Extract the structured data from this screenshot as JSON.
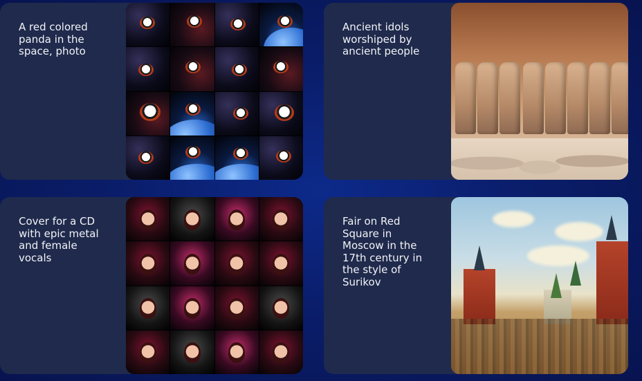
{
  "cards": [
    {
      "text": "A red colored\npanda in the\nspace, photo",
      "image_alt": "red panda in space grid"
    },
    {
      "text": "Ancient idols\nworshiped by\nancient people",
      "image_alt": "ancient stone idols"
    },
    {
      "text": "Cover for a CD\nwith epic metal\nand female\nvocals",
      "image_alt": "metal album covers grid"
    },
    {
      "text": "Fair on Red\nSquare in\nMoscow in the\n17th century in\nthe style of\nSurikov",
      "image_alt": "Red Square painting"
    }
  ],
  "colors": {
    "background": "#0a1d6a",
    "card": "#1f2a4c",
    "text": "#f2f3f7"
  }
}
